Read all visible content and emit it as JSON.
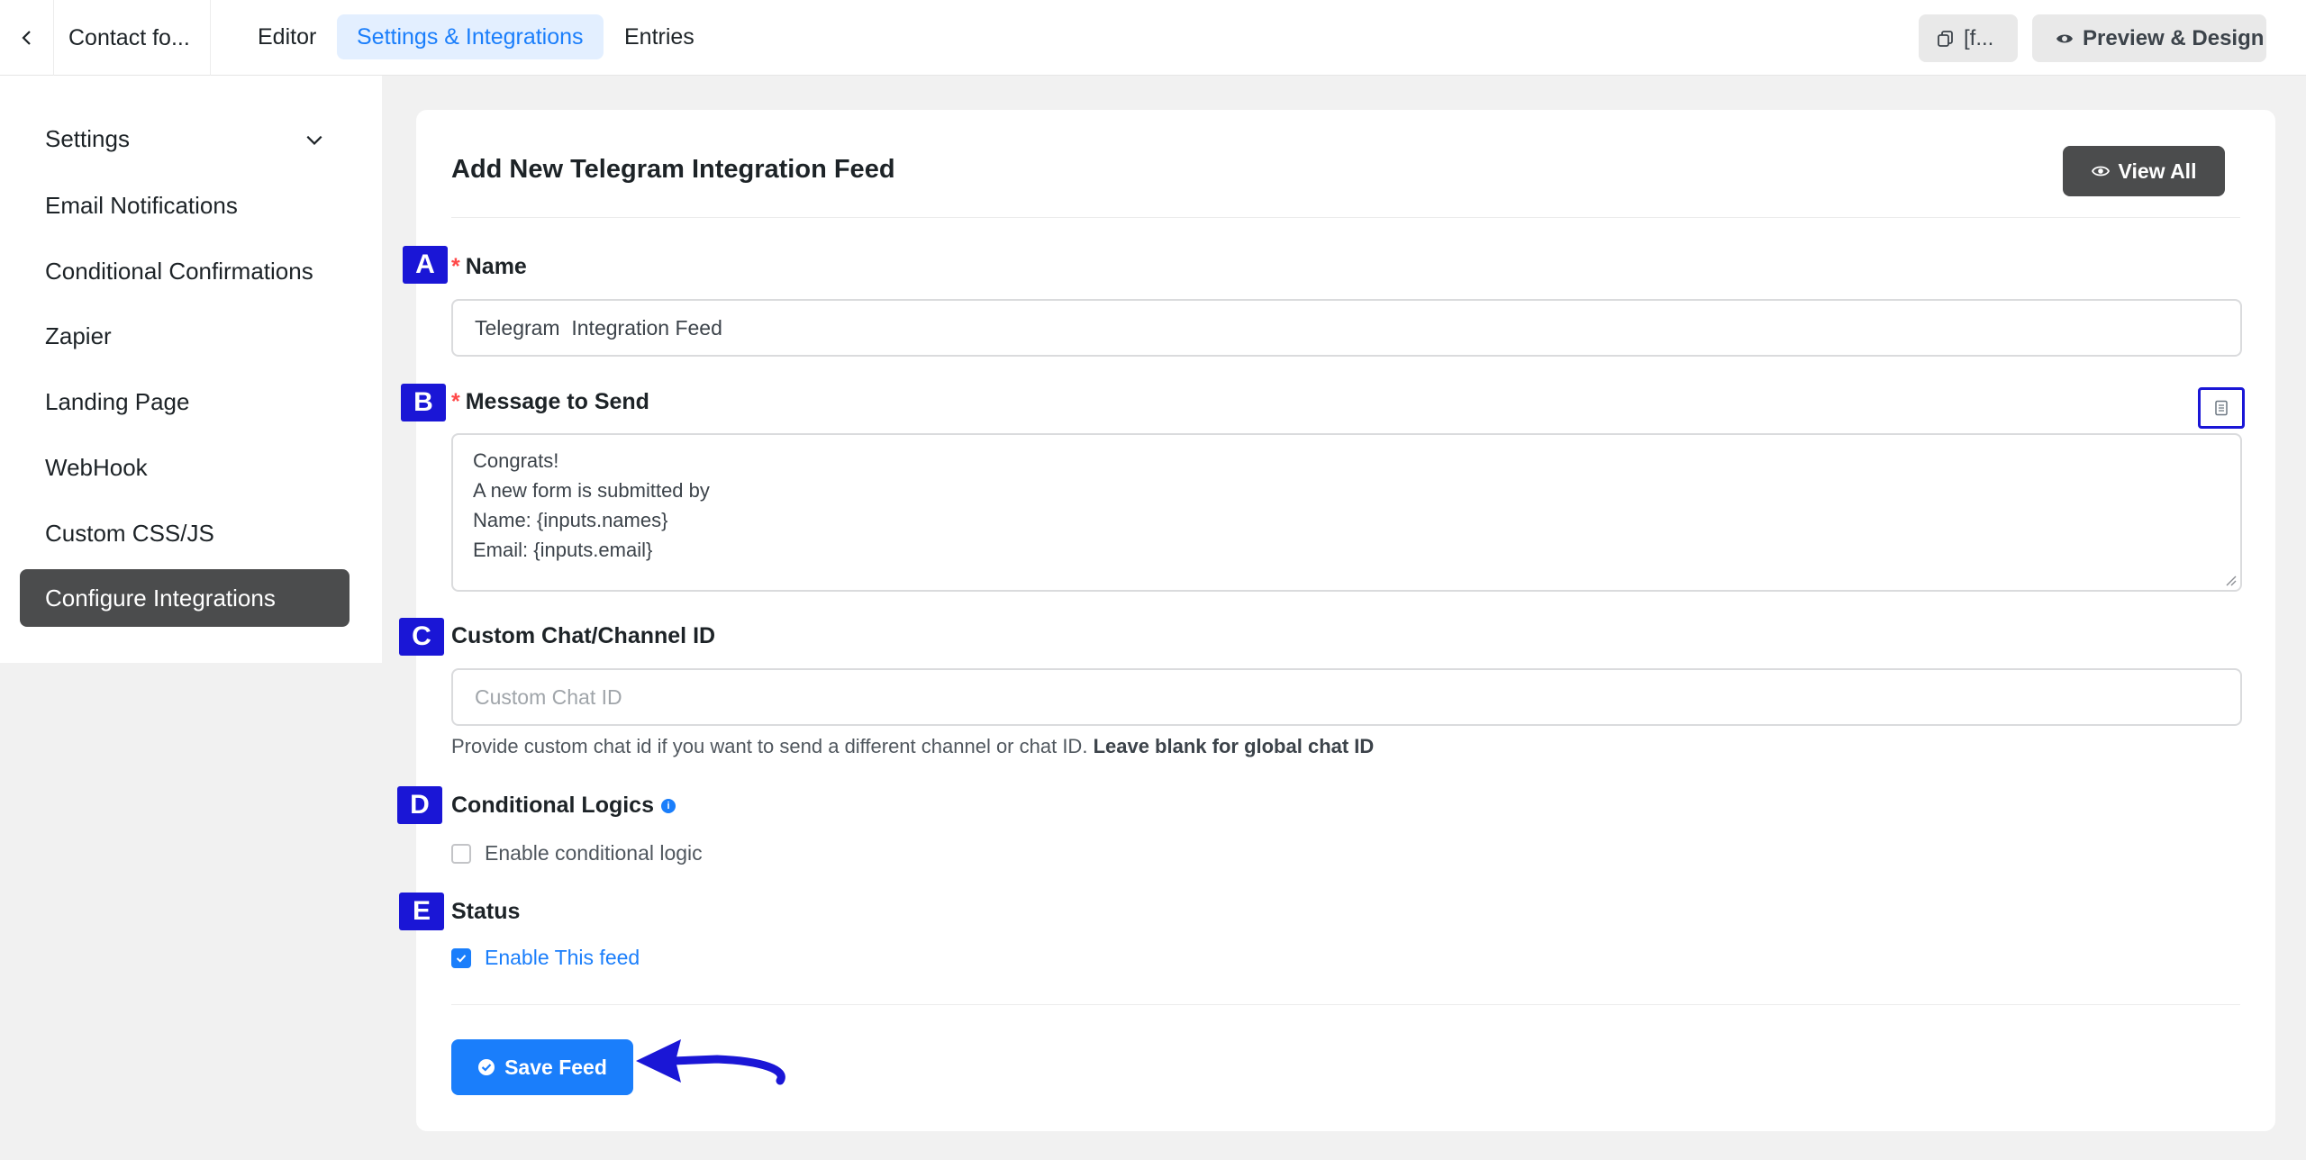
{
  "topbar": {
    "back_icon": "chevron-left-icon",
    "form_title": "Contact fo...",
    "tabs": [
      {
        "label": "Editor",
        "active": false
      },
      {
        "label": "Settings & Integrations",
        "active": true
      },
      {
        "label": "Entries",
        "active": false
      }
    ],
    "shortcode_button": "[f...",
    "preview_button": "Preview & Design"
  },
  "sidebar": {
    "items": [
      {
        "label": "Settings",
        "has_chevron": true
      },
      {
        "label": "Email Notifications"
      },
      {
        "label": "Conditional Confirmations"
      },
      {
        "label": "Zapier"
      },
      {
        "label": "Landing Page"
      },
      {
        "label": "WebHook"
      },
      {
        "label": "Custom CSS/JS"
      },
      {
        "label": "Configure Integrations",
        "active": true
      }
    ]
  },
  "main": {
    "title": "Add New Telegram Integration Feed",
    "view_all_label": "View All",
    "name": {
      "label": "Name",
      "required": "*",
      "value": "Telegram  Integration Feed"
    },
    "message": {
      "label": "Message to Send",
      "required": "*",
      "lines": [
        "Congrats!",
        "A new form is submitted by",
        "Name: {inputs.names}",
        "Email: {inputs.email}"
      ]
    },
    "chat_id": {
      "label": "Custom Chat/Channel ID",
      "placeholder": "Custom Chat ID",
      "help": "Provide custom chat id if you want to send a different channel or chat ID.",
      "help_bold": "Leave blank for global chat ID"
    },
    "conditional": {
      "label": "Conditional Logics",
      "info_icon": "i",
      "checkbox_label": "Enable conditional logic",
      "checked": false
    },
    "status": {
      "label": "Status",
      "checkbox_label": "Enable This feed",
      "checked": true
    },
    "save_label": "Save Feed"
  },
  "annotations": {
    "badges": [
      "A",
      "B",
      "C",
      "D",
      "E"
    ]
  },
  "colors": {
    "accent": "#1a7efb",
    "annotation": "#1a16d6",
    "dark_button": "#4b4c4d"
  }
}
